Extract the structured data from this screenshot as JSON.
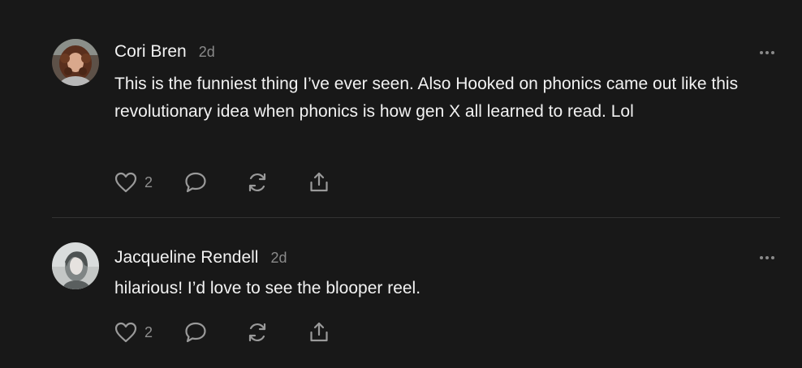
{
  "comments": [
    {
      "author": "Cori Bren",
      "time": "2d",
      "text": "This is the funniest thing I’ve ever seen. Also Hooked on phonics came out like this revolutionary idea when phonics is how gen X all learned to read. Lol",
      "likes": "2",
      "icons": [
        "heart-icon",
        "comment-icon",
        "restack-icon",
        "share-icon",
        "more-icon"
      ]
    },
    {
      "author": "Jacqueline Rendell",
      "time": "2d",
      "text": "hilarious! I’d love to see the blooper reel.",
      "likes": "2",
      "icons": [
        "heart-icon",
        "comment-icon",
        "restack-icon",
        "share-icon",
        "more-icon"
      ]
    }
  ],
  "colors": {
    "background": "#181818",
    "text": "#f2f2f2",
    "muted": "#8a8a8a",
    "divider": "#333333"
  }
}
